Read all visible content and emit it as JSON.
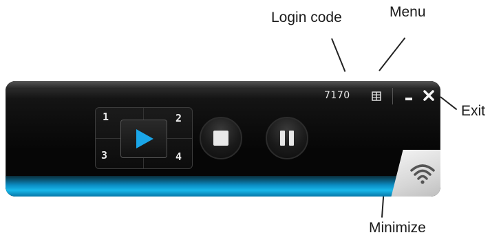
{
  "annotations": {
    "login_code": "Login code",
    "menu": "Menu",
    "exit": "Exit",
    "minimize": "Minimize"
  },
  "toolbar": {
    "code_value": "7170",
    "menu_icon": "menu-icon",
    "minimize_icon": "minimize-icon",
    "exit_icon": "close-icon"
  },
  "controls": {
    "quadrants": [
      "1",
      "2",
      "3",
      "4"
    ],
    "play_icon": "play-icon",
    "stop_icon": "stop-icon",
    "pause_icon": "pause-icon",
    "wifi_icon": "wifi-icon"
  },
  "colors": {
    "accent": "#19b8ea",
    "widget_bg": "#060606",
    "play": "#1aa6e8"
  }
}
